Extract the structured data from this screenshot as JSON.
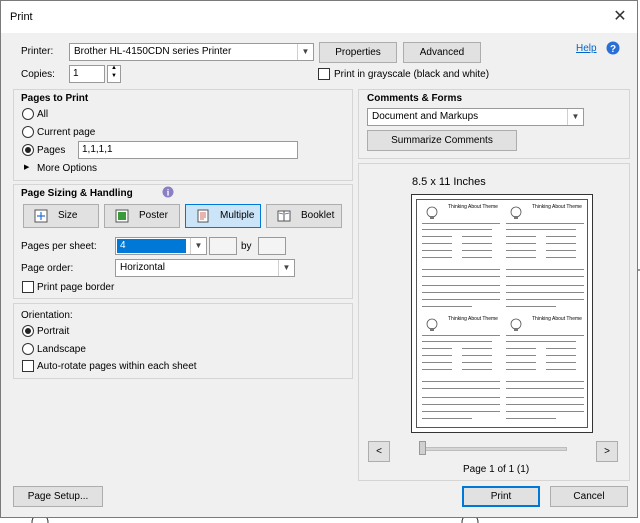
{
  "window": {
    "title": "Print",
    "close_glyph": "✕",
    "help_label": "Help"
  },
  "printer": {
    "label": "Printer:",
    "selected": "Brother HL-4150CDN series Printer",
    "properties_label": "Properties",
    "advanced_label": "Advanced"
  },
  "copies": {
    "label": "Copies:",
    "value": "1"
  },
  "grayscale": {
    "label": "Print in grayscale (black and white)",
    "checked": false
  },
  "pages_to_print": {
    "heading": "Pages to Print",
    "options": [
      {
        "label": "All",
        "selected": false
      },
      {
        "label": "Current page",
        "selected": false
      },
      {
        "label": "Pages",
        "selected": true
      }
    ],
    "pages_value": "1,1,1,1",
    "more_options_label": "More Options"
  },
  "sizing": {
    "heading": "Page Sizing & Handling",
    "buttons": [
      {
        "label": "Size",
        "icon": "size-icon",
        "selected": false
      },
      {
        "label": "Poster",
        "icon": "poster-icon",
        "selected": false
      },
      {
        "label": "Multiple",
        "icon": "multiple-icon",
        "selected": true
      },
      {
        "label": "Booklet",
        "icon": "booklet-icon",
        "selected": false
      }
    ],
    "pages_per_sheet_label": "Pages per sheet:",
    "pages_per_sheet_value": "4",
    "by_label": "by",
    "page_order_label": "Page order:",
    "page_order_value": "Horizontal",
    "print_page_border_label": "Print page border"
  },
  "orientation": {
    "heading": "Orientation:",
    "options": [
      {
        "label": "Portrait",
        "selected": true
      },
      {
        "label": "Landscape",
        "selected": false
      }
    ],
    "auto_rotate_label": "Auto-rotate pages within each sheet"
  },
  "comments": {
    "heading": "Comments & Forms",
    "selected": "Document and Markups",
    "summarize_label": "Summarize Comments"
  },
  "preview": {
    "paper_size": "8.5 x 11 Inches",
    "page_indicator": "Page 1 of 1 (1)",
    "thumbnail_title": "Thinking About Theme",
    "prev_glyph": "<",
    "next_glyph": ">"
  },
  "footer": {
    "page_setup_label": "Page Setup...",
    "print_label": "Print",
    "cancel_label": "Cancel"
  },
  "colors": {
    "accent": "#0078d7",
    "selected_button_bg": "#cce4f7",
    "dialog_bg": "#f0f0f0",
    "link": "#0066cc"
  }
}
